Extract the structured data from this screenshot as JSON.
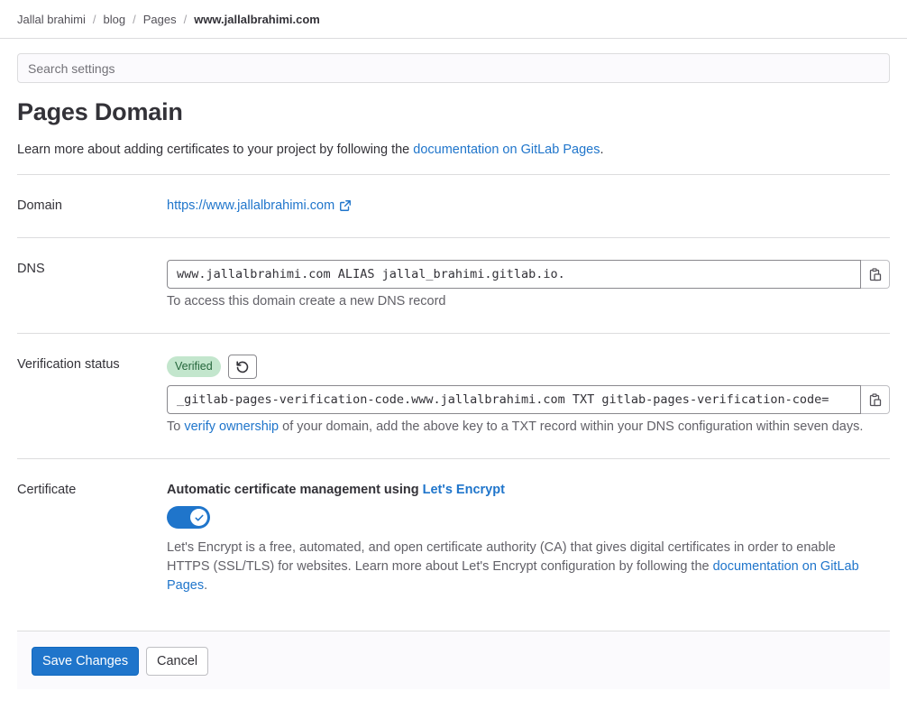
{
  "breadcrumb": {
    "items": [
      "Jallal brahimi",
      "blog",
      "Pages"
    ],
    "current": "www.jallalbrahimi.com"
  },
  "search": {
    "placeholder": "Search settings"
  },
  "page": {
    "title": "Pages Domain",
    "intro_prefix": "Learn more about adding certificates to your project by following the ",
    "intro_link": "documentation on GitLab Pages",
    "intro_suffix": "."
  },
  "domain": {
    "label": "Domain",
    "url": "https://www.jallalbrahimi.com",
    "icon": "external-link-icon"
  },
  "dns": {
    "label": "DNS",
    "record": "www.jallalbrahimi.com ALIAS jallal_brahimi.gitlab.io.",
    "help": "To access this domain create a new DNS record",
    "copy_icon": "copy-to-clipboard-icon"
  },
  "verification": {
    "label": "Verification status",
    "badge": "Verified",
    "retry_icon": "retry-icon",
    "record": "_gitlab-pages-verification-code.www.jallalbrahimi.com TXT gitlab-pages-verification-code=",
    "help_prefix": "To ",
    "help_link": "verify ownership",
    "help_suffix": " of your domain, add the above key to a TXT record within your DNS configuration within seven days."
  },
  "certificate": {
    "label": "Certificate",
    "title_prefix": "Automatic certificate management using ",
    "title_link": "Let's Encrypt",
    "toggle_on": true,
    "help_text": "Let's Encrypt is a free, automated, and open certificate authority (CA) that gives digital certificates in order to enable HTTPS (SSL/TLS) for websites. Learn more about Let's Encrypt configuration by following the ",
    "help_link": "documentation on GitLab Pages",
    "help_suffix": "."
  },
  "footer": {
    "save_label": "Save Changes",
    "cancel_label": "Cancel"
  },
  "colors": {
    "link": "#1f75cb",
    "primary": "#1f75cb",
    "badge_bg": "#c3e6cd",
    "badge_text": "#24663b"
  }
}
